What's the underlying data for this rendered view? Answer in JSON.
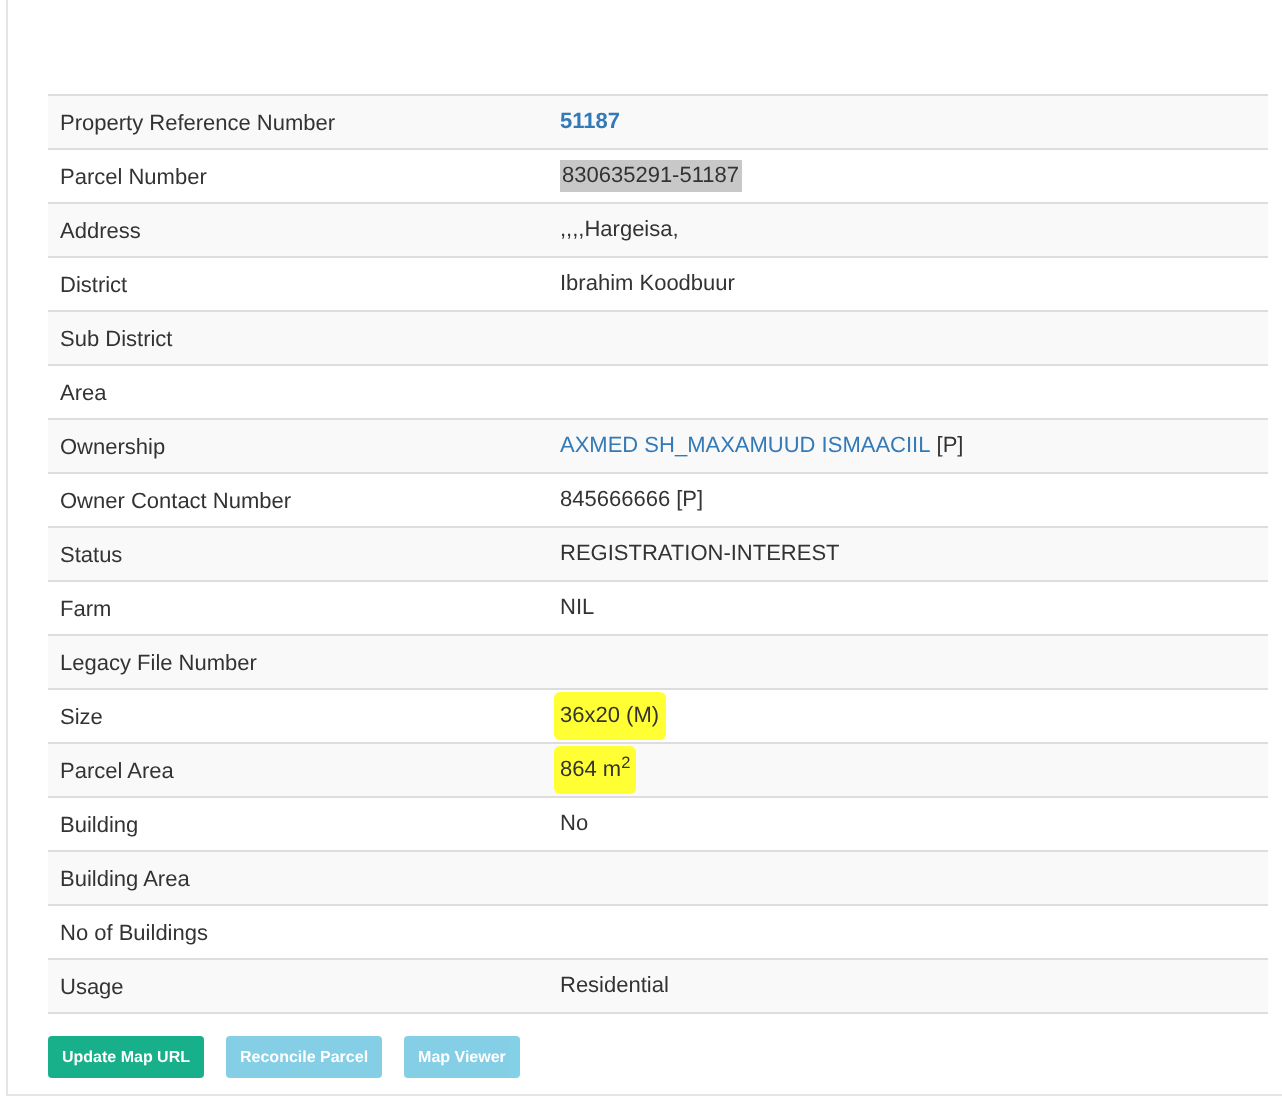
{
  "rows": [
    {
      "label": "Property Reference Number",
      "value": "51187",
      "link": true,
      "bold": true,
      "text_selected": false,
      "marker_highlight": false
    },
    {
      "label": "Parcel Number",
      "value": "830635291-51187",
      "link": false,
      "bold": false,
      "text_selected": true,
      "marker_highlight": false
    },
    {
      "label": "Address",
      "value": ",,,,Hargeisa,",
      "link": false,
      "bold": false,
      "text_selected": false,
      "marker_highlight": false
    },
    {
      "label": "District",
      "value": "Ibrahim Koodbuur",
      "link": false,
      "bold": false,
      "text_selected": false,
      "marker_highlight": false
    },
    {
      "label": "Sub District"
    },
    {
      "label": "Area"
    },
    {
      "label": "Ownership",
      "value": "AXMED SH_MAXAMUUD ISMAACIIL",
      "link": true,
      "bold": false,
      "suffix": " [P]",
      "text_selected": false,
      "marker_highlight": false
    },
    {
      "label": "Owner Contact Number",
      "value": "845666666 [P]",
      "link": false,
      "bold": false,
      "text_selected": false,
      "marker_highlight": false
    },
    {
      "label": "Status",
      "value": "REGISTRATION-INTEREST",
      "link": false,
      "bold": false,
      "text_selected": false,
      "marker_highlight": false
    },
    {
      "label": "Farm",
      "value": "NIL",
      "link": false,
      "bold": false,
      "text_selected": false,
      "marker_highlight": false
    },
    {
      "label": "Legacy File Number"
    },
    {
      "label": "Size",
      "value": "36x20 (M)",
      "link": false,
      "bold": false,
      "text_selected": false,
      "marker_highlight": true
    },
    {
      "label": "Parcel Area",
      "value": "864 m$^{2}$",
      "link": false,
      "bold": false,
      "text_selected": false,
      "marker_highlight": true
    },
    {
      "label": "Building",
      "value": "No",
      "link": false,
      "bold": false,
      "text_selected": false,
      "marker_highlight": false
    },
    {
      "label": "Building Area"
    },
    {
      "label": "No of Buildings"
    },
    {
      "label": "Usage",
      "value": "Residential",
      "link": false,
      "bold": false,
      "text_selected": false,
      "marker_highlight": false
    }
  ],
  "buttons": [
    {
      "label": "Update Map URL",
      "kind": "success",
      "disabled": false
    },
    {
      "label": "Reconcile Parcel",
      "kind": "info",
      "disabled": true
    },
    {
      "label": "Map Viewer",
      "kind": "info",
      "disabled": true
    }
  ]
}
